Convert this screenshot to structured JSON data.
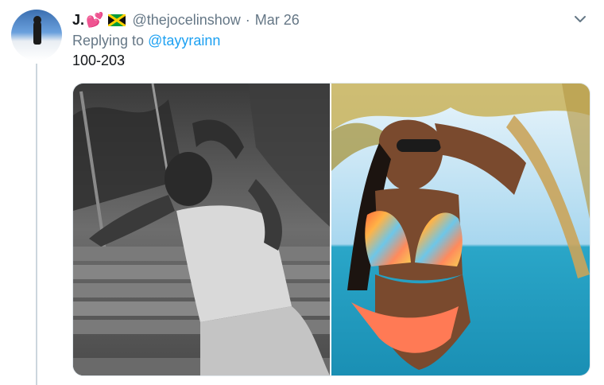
{
  "tweet": {
    "display_name": "J.",
    "name_emoji": "💕",
    "handle": "@thejocelinshow",
    "separator": "·",
    "date": "Mar 26",
    "replying_prefix": "Replying to",
    "replying_to": "@tayyrainn",
    "text": "100-203"
  },
  "icons": {
    "avatar": "profile-photo",
    "flag": "jamaica-flag-icon",
    "menu": "chevron-down-icon"
  },
  "colors": {
    "link": "#1da1f2",
    "secondary_text": "#657786",
    "thread_line": "#ccd6dd"
  }
}
